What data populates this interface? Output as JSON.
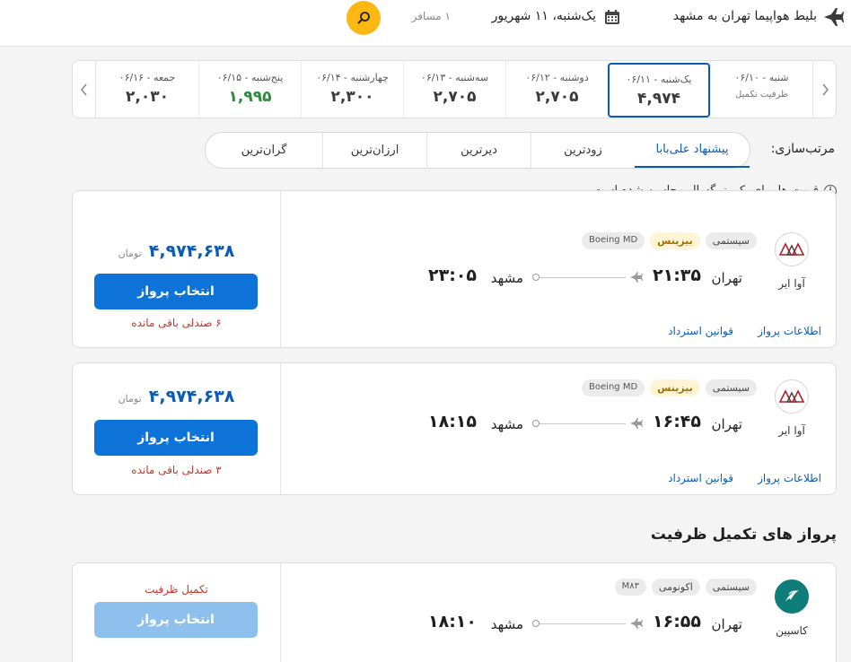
{
  "header": {
    "route_title": "بلیط هواپیما تهران به مشهد",
    "date": "یک‌شنبه، ۱۱ شهریور",
    "passengers": "۱ مسافر"
  },
  "date_strip": [
    {
      "label": "شنبه - ۰۶/۱۰",
      "price": "",
      "note": "ظرفیت تکمیل",
      "state": "full"
    },
    {
      "label": "یک‌شنبه - ۰۶/۱۱",
      "price": "۴,۹۷۴",
      "note": "",
      "state": "selected"
    },
    {
      "label": "دوشنبه - ۰۶/۱۲",
      "price": "۲,۷۰۵",
      "note": "",
      "state": "normal"
    },
    {
      "label": "سه‌شنبه - ۰۶/۱۳",
      "price": "۲,۷۰۵",
      "note": "",
      "state": "normal"
    },
    {
      "label": "چهارشنبه - ۰۶/۱۴",
      "price": "۲,۳۰۰",
      "note": "",
      "state": "normal"
    },
    {
      "label": "پنج‌شنبه - ۰۶/۱۵",
      "price": "۱,۹۹۵",
      "note": "",
      "state": "cheapest"
    },
    {
      "label": "جمعه - ۰۶/۱۶",
      "price": "۲,۰۳۰",
      "note": "",
      "state": "normal"
    }
  ],
  "sort": {
    "label": "مرتب‌سازی:",
    "options": [
      "پیشنهاد علی‌بابا",
      "زودترین",
      "دیرترین",
      "ارزان‌ترین",
      "گران‌ترین"
    ],
    "active_index": 0
  },
  "info_note": "قیمت ها برای یک بزرگسال محاسبه شده است.",
  "flights": [
    {
      "airline": "آوا ایر",
      "logo_text": "AVA",
      "tags": [
        "سیستمی",
        "بیزینس",
        "Boeing MD"
      ],
      "origin": "تهران",
      "dep_time": "۲۱:۳۵",
      "destination": "مشهد",
      "arr_time": "۲۳:۰۵",
      "price": "۴,۹۷۴,۶۳۸",
      "currency": "تومان",
      "button": "انتخاب پرواز",
      "seats": "۶ صندلی باقی مانده",
      "links": [
        "اطلاعات پرواز",
        "قوانین استرداد"
      ]
    },
    {
      "airline": "آوا ایر",
      "logo_text": "AVA",
      "tags": [
        "سیستمی",
        "بیزینس",
        "Boeing MD"
      ],
      "origin": "تهران",
      "dep_time": "۱۶:۴۵",
      "destination": "مشهد",
      "arr_time": "۱۸:۱۵",
      "price": "۴,۹۷۴,۶۳۸",
      "currency": "تومان",
      "button": "انتخاب پرواز",
      "seats": "۳ صندلی باقی مانده",
      "links": [
        "اطلاعات پرواز",
        "قوانین استرداد"
      ]
    }
  ],
  "full_section_title": "پرواز های تکمیل ظرفیت",
  "full_flights": [
    {
      "airline": "کاسپین",
      "tags": [
        "سیستمی",
        "اکونومی",
        "M۸۳"
      ],
      "origin": "تهران",
      "dep_time": "۱۶:۵۵",
      "destination": "مشهد",
      "arr_time": "۱۸:۱۰",
      "status": "تکمیل ظرفیت",
      "button": "انتخاب پرواز"
    }
  ],
  "colors": {
    "primary": "#0d73d8",
    "link": "#0b5bb5",
    "search_button": "#fdb713",
    "cheapest_price": "#2e8b3d",
    "warning": "#c0392b",
    "caspian_logo": "#0f7d79"
  },
  "icons": [
    "airplane-icon",
    "calendar-icon",
    "search-icon",
    "chevron-right-icon",
    "chevron-left-icon",
    "info-icon",
    "ava-air-logo",
    "caspian-logo"
  ]
}
